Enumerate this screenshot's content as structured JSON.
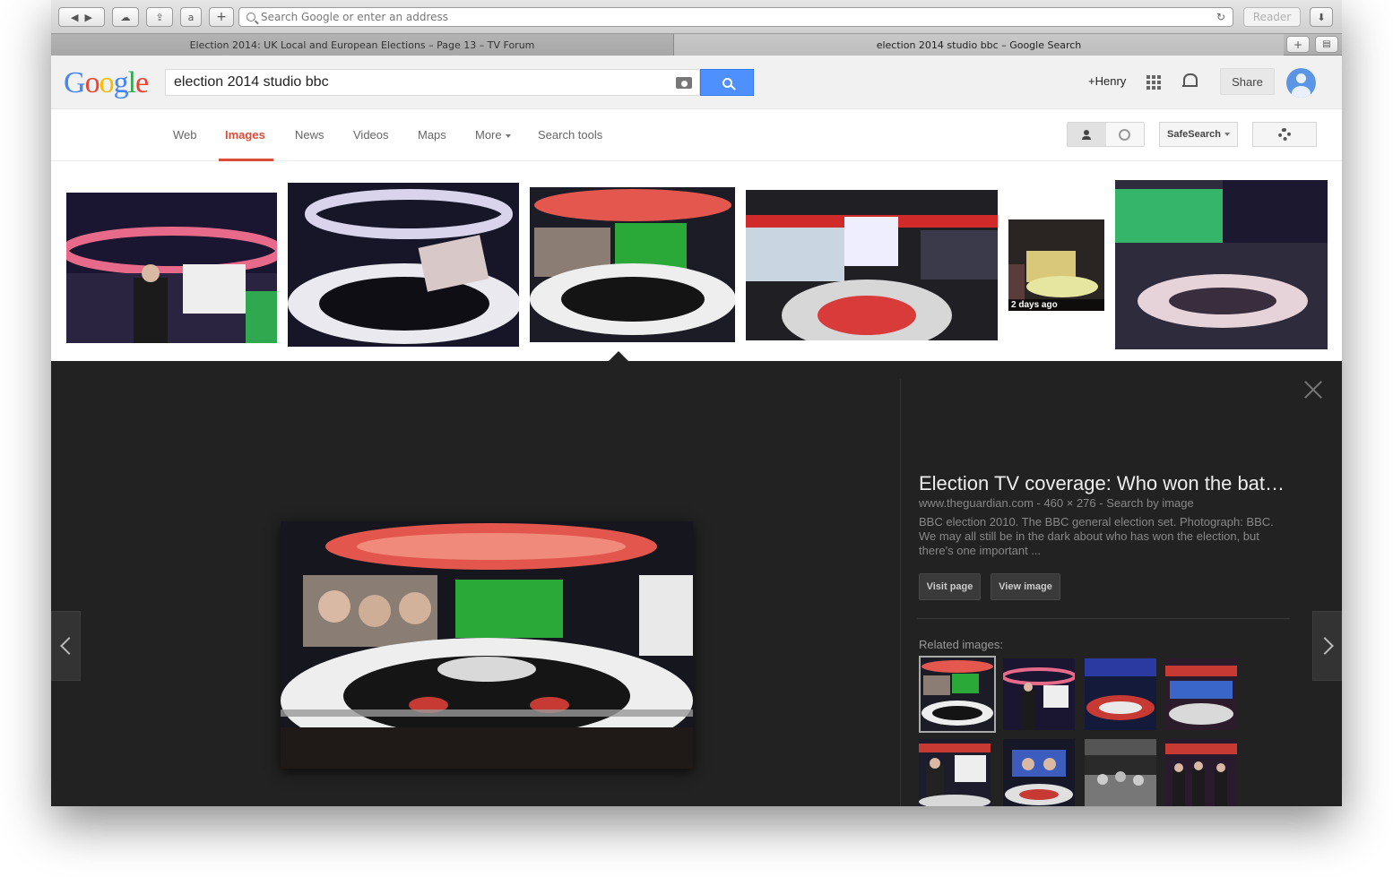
{
  "browser": {
    "address_placeholder": "Search Google or enter an address",
    "reader_label": "Reader",
    "tabs": [
      {
        "title": "Election 2014: UK Local and European Elections – Page 13 – TV Forum"
      },
      {
        "title": "election 2014 studio bbc – Google Search"
      }
    ]
  },
  "google": {
    "logo": "Google",
    "query": "election 2014 studio bbc",
    "user": "+Henry",
    "share_label": "Share",
    "nav": [
      "Web",
      "Images",
      "News",
      "Videos",
      "Maps",
      "More",
      "Search tools"
    ],
    "safesearch_label": "SafeSearch"
  },
  "results": {
    "badge": "2 days ago"
  },
  "viewer": {
    "title": "Election TV coverage: Who won the bat…",
    "meta": "www.theguardian.com - 460 × 276 - Search by image",
    "description": "BBC election 2010. The BBC general election set. Photograph: BBC. We may all still be in the dark about who has won the election, but there's one important ...",
    "visit_label": "Visit page",
    "view_label": "View image",
    "related_label": "Related images:"
  },
  "colors": {
    "accent_red": "#dd4b39",
    "search_blue": "#4d90fe",
    "viewer_bg": "#222222"
  }
}
